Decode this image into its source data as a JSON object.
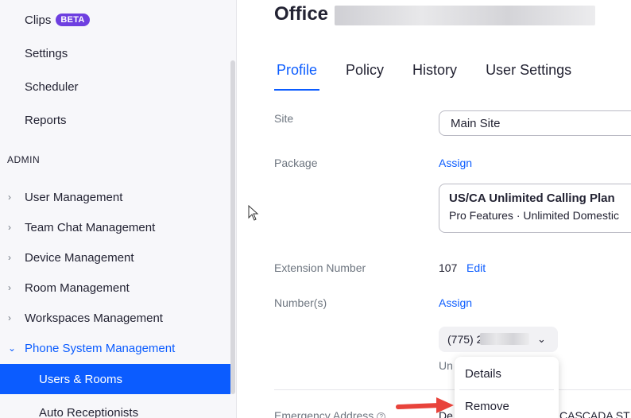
{
  "sidebar": {
    "top_items": [
      {
        "label": "Clips",
        "badge": "BETA"
      },
      {
        "label": "Settings"
      },
      {
        "label": "Scheduler"
      },
      {
        "label": "Reports"
      }
    ],
    "section_title": "ADMIN",
    "admin_items": [
      {
        "label": "User Management"
      },
      {
        "label": "Team Chat Management"
      },
      {
        "label": "Device Management"
      },
      {
        "label": "Room Management"
      },
      {
        "label": "Workspaces Management"
      },
      {
        "label": "Phone System Management"
      }
    ],
    "sub_items": [
      {
        "label": "Users & Rooms"
      },
      {
        "label": "Auto Receptionists"
      }
    ]
  },
  "main": {
    "title": "Office",
    "tabs": [
      {
        "label": "Profile"
      },
      {
        "label": "Policy"
      },
      {
        "label": "History"
      },
      {
        "label": "User Settings"
      }
    ],
    "site": {
      "label": "Site",
      "value": "Main Site"
    },
    "package": {
      "label": "Package",
      "assign": "Assign",
      "plan_title": "US/CA Unlimited Calling Plan",
      "plan_sub": "Pro Features · Unlimited Domestic"
    },
    "extension": {
      "label": "Extension Number",
      "value": "107",
      "edit": "Edit"
    },
    "numbers": {
      "label": "Number(s)",
      "assign": "Assign",
      "number_prefix": "(775) 2",
      "under_text": "Un"
    },
    "emergency": {
      "label": "Emergency Address",
      "value_left": "De",
      "value_right": "CASCADA ST"
    }
  },
  "context_menu": {
    "items": [
      {
        "label": "Details"
      },
      {
        "label": "Remove"
      }
    ]
  },
  "colors": {
    "accent": "#0b5cff",
    "badge": "#6e3fe0",
    "arrow": "#e8433b"
  }
}
